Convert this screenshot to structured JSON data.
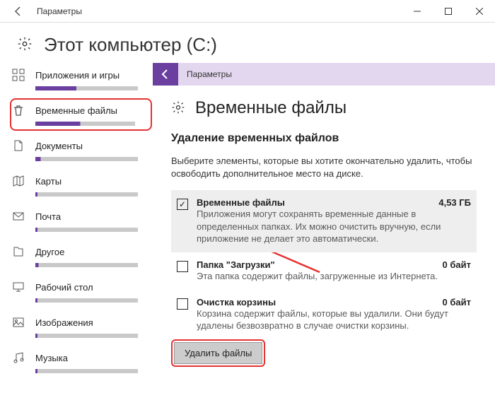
{
  "window": {
    "title": "Параметры"
  },
  "header": {
    "title": "Этот компьютер (C:)"
  },
  "sidebar": {
    "items": [
      {
        "label": "Приложения и игры",
        "icon": "apps",
        "progress": 40
      },
      {
        "label": "Временные файлы",
        "icon": "trash",
        "progress": 45,
        "highlight": true
      },
      {
        "label": "Документы",
        "icon": "doc",
        "progress": 5
      },
      {
        "label": "Карты",
        "icon": "map",
        "progress": 2
      },
      {
        "label": "Почта",
        "icon": "mail",
        "progress": 2
      },
      {
        "label": "Другое",
        "icon": "other",
        "progress": 3
      },
      {
        "label": "Рабочий стол",
        "icon": "desktop",
        "progress": 2
      },
      {
        "label": "Изображения",
        "icon": "images",
        "progress": 2
      },
      {
        "label": "Музыка",
        "icon": "music",
        "progress": 2
      }
    ]
  },
  "pane": {
    "back_title": "Параметры",
    "heading": "Временные файлы",
    "subheading": "Удаление временных файлов",
    "description": "Выберите элементы, которые вы хотите окончательно удалить, чтобы освободить дополнительное место на диске.",
    "options": [
      {
        "title": "Временные файлы",
        "size": "4,53 ГБ",
        "checked": true,
        "desc": "Приложения могут сохранять временные данные в определенных папках. Их можно очистить вручную, если приложение не делает это автоматически."
      },
      {
        "title": "Папка \"Загрузки\"",
        "size": "0 байт",
        "checked": false,
        "desc": "Эта папка содержит файлы, загруженные из Интернета."
      },
      {
        "title": "Очистка корзины",
        "size": "0 байт",
        "checked": false,
        "desc": "Корзина содержит файлы, которые вы удалили. Они будут удалены безвозвратно в случае очистки корзины."
      }
    ],
    "delete_label": "Удалить файлы"
  }
}
